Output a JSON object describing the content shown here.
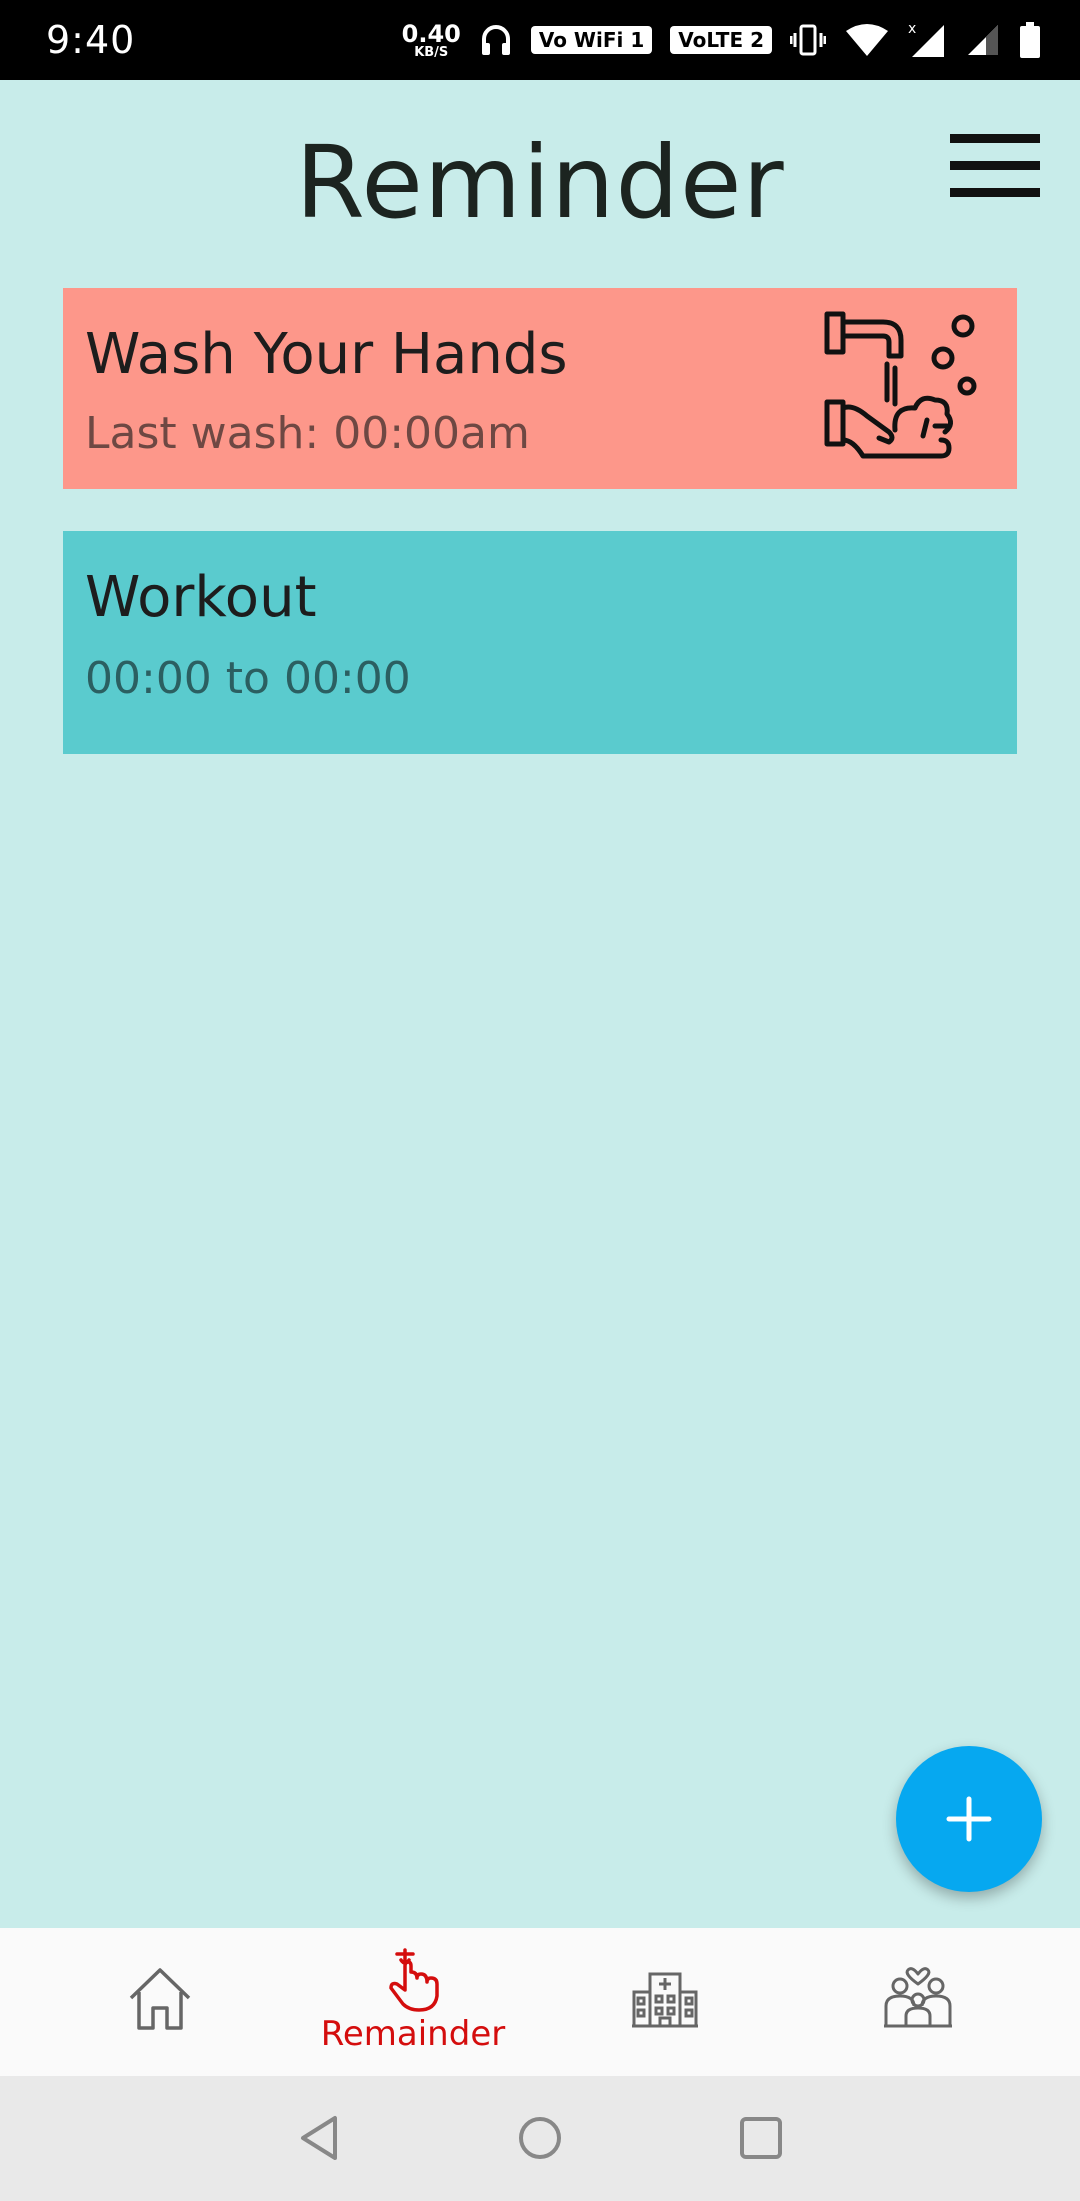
{
  "status_bar": {
    "time": "9:40",
    "speed_value": "0.40",
    "speed_unit": "KB/S",
    "wifi_badge": "Vo WiFi 1",
    "lte_badge": "VoLTE 2"
  },
  "header": {
    "title": "Reminder"
  },
  "cards": [
    {
      "title": "Wash Your Hands",
      "subtitle": "Last wash: 00:00am",
      "color": "#fd978a",
      "icon": "hand-wash-icon"
    },
    {
      "title": "Workout",
      "subtitle": "00:00 to 00:00",
      "color": "#5acbce"
    }
  ],
  "fab": {
    "icon": "plus-icon",
    "color": "#06a8f0"
  },
  "bottom_nav": {
    "items": [
      {
        "icon": "home-icon"
      },
      {
        "icon": "reminder-finger-icon",
        "label": "Remainder",
        "active": true
      },
      {
        "icon": "hospital-icon"
      },
      {
        "icon": "family-icon"
      }
    ],
    "active_color": "#d40d0d"
  },
  "colors": {
    "background": "#c8ecea",
    "accent": "#06a8f0"
  }
}
